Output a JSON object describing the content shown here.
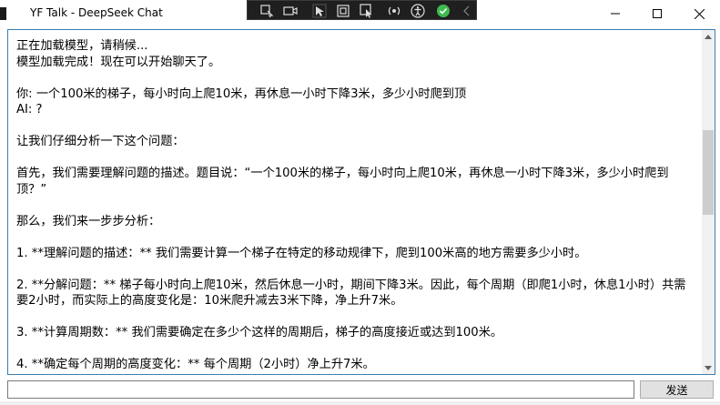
{
  "window": {
    "title": "YF Talk - DeepSeek Chat"
  },
  "titlebar_controls": {
    "minimize_icon": "minimize-icon",
    "maximize_icon": "maximize-icon",
    "close_icon": "close-icon"
  },
  "overlay_toolbar": {
    "icons": [
      "select-element-icon",
      "record-icon",
      "pointer-icon",
      "frame-icon",
      "pointer-frame-icon",
      "radio-icon",
      "accessibility-icon",
      "check-circle-icon",
      "chevron-left-icon"
    ],
    "check_color": "#3fb950"
  },
  "chat": {
    "lines": [
      "正在加载模型，请稍候...",
      "模型加载完成！现在可以开始聊天了。",
      "",
      "你: 一个100米的梯子，每小时向上爬10米，再休息一小时下降3米，多少小时爬到顶",
      "AI: ?",
      "",
      "让我们仔细分析一下这个问题：",
      "",
      "首先，我们需要理解问题的描述。题目说：“一个100米的梯子，每小时向上爬10米，再休息一小时下降3米，多少小时爬到顶？”",
      "",
      "那么，我们来一步步分析：",
      "",
      "1. **理解问题的描述：** 我们需要计算一个梯子在特定的移动规律下，爬到100米高的地方需要多少小时。",
      "",
      "2. **分解问题：** 梯子每小时向上爬10米，然后休息一小时，期间下降3米。因此，每个周期（即爬1小时，休息1小时）共需要2小时，而实际上的高度变化是：10米爬升减去3米下降，净上升7米。",
      "",
      "3. **计算周期数：** 我们需要确定在多少个这样的周期后，梯子的高度接近或达到100米。",
      "",
      "4. **确定每个周期的高度变化：** 每个周期（2小时）净上升7米。"
    ]
  },
  "input": {
    "value": "",
    "placeholder": ""
  },
  "send_button": {
    "label": "发送"
  },
  "colors": {
    "frame_border": "#3c7fb1",
    "scroll_thumb": "#cdcdcd",
    "button_bg": "#e1e1e1"
  }
}
